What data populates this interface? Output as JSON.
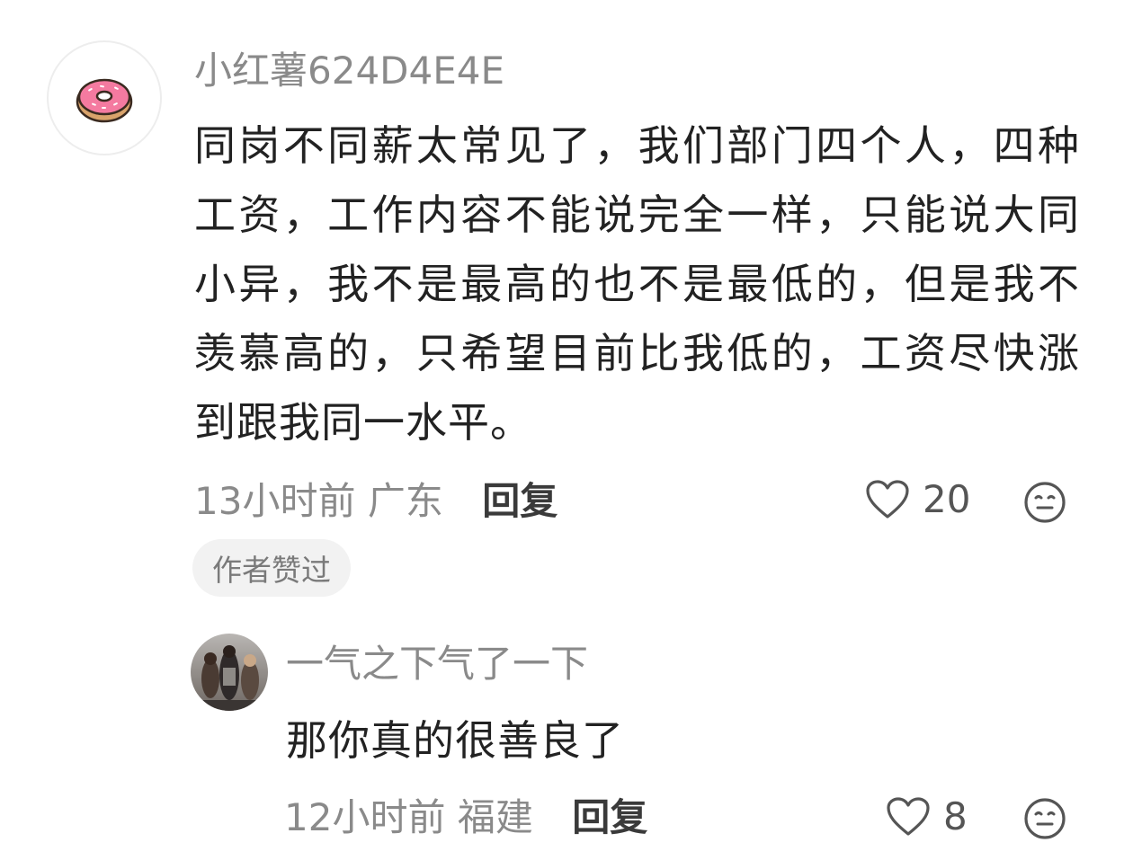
{
  "main_comment": {
    "username": "小红薯624D4E4E",
    "avatar_icon": "donut-icon",
    "text": "同岗不同薪太常见了，我们部门四个人，四种工资，工作内容不能说完全一样，只能说大同小异，我不是最高的也不是最低的，但是我不羡慕高的，只希望目前比我低的，工资尽快涨到跟我同一水平。",
    "time": "13小时前",
    "location": "广东",
    "reply_label": "回复",
    "like_count": "20",
    "badge": "作者赞过"
  },
  "reply_comment": {
    "username": "一气之下气了一下",
    "avatar_icon": "photo-avatar",
    "text": "那你真的很善良了",
    "time": "12小时前",
    "location": "福建",
    "reply_label": "回复",
    "like_count": "8"
  },
  "colors": {
    "secondary_text": "#8a8a8a",
    "primary_text": "#222222",
    "badge_bg": "#f2f2f2",
    "donut_frosting": "#f47aa0"
  }
}
